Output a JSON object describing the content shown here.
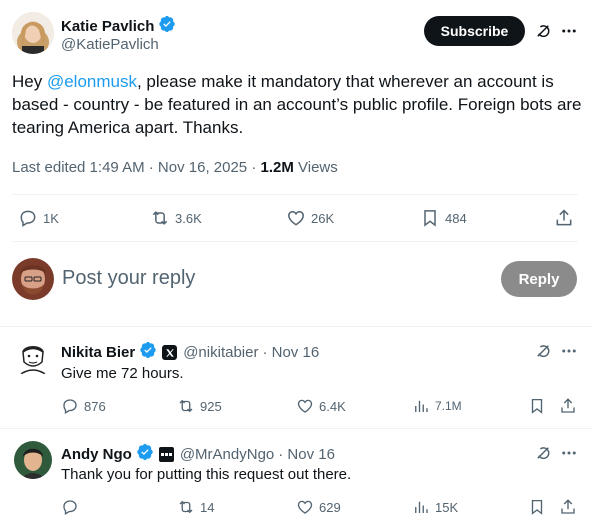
{
  "main_post": {
    "author_name": "Katie Pavlich",
    "author_handle": "@KatiePavlich",
    "subscribe_label": "Subscribe",
    "text_before_mention": "Hey ",
    "mention": "@elonmusk",
    "text_after_mention": ", please make it mandatory that wherever an account is based - country - be featured in an account’s public profile. Foreign bots are tearing America apart. Thanks.",
    "edited_time": "Last edited 1:49 AM · Nov 16, 2025 · ",
    "views_count": "1.2M",
    "views_label": " Views",
    "stats": {
      "replies": "1K",
      "reposts": "3.6K",
      "likes": "26K",
      "bookmarks": "484"
    }
  },
  "reply_composer": {
    "placeholder": "Post your reply",
    "reply_button": "Reply"
  },
  "replies": [
    {
      "author_name": "Nikita Bier",
      "author_handle": "@nikitabier",
      "time": "· Nov 16",
      "text": "Give me 72 hours.",
      "stats": {
        "replies": "876",
        "reposts": "925",
        "likes": "6.4K",
        "views": "7.1M"
      }
    },
    {
      "author_name": "Andy Ngo",
      "author_handle": "@MrAndyNgo",
      "time": "· Nov 16",
      "text": "Thank you for putting this request out there.",
      "stats": {
        "replies": "",
        "reposts": "14",
        "likes": "629",
        "views": "15K"
      }
    }
  ],
  "colors": {
    "accent": "#1d9bf0",
    "text": "#0f1419",
    "muted": "#536471",
    "subscribe_bg": "#0f1419",
    "reply_button_bg": "#8b8b8b"
  },
  "icons": [
    "verified-badge-icon",
    "grok-icon",
    "more-icon",
    "reply-icon",
    "repost-icon",
    "like-icon",
    "bookmark-icon",
    "share-icon",
    "views-icon",
    "affiliate-badge-icon"
  ]
}
